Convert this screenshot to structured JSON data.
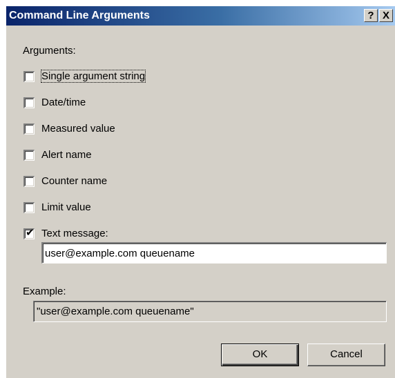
{
  "dialog": {
    "title": "Command Line Arguments",
    "help_button": "?",
    "close_button": "X"
  },
  "arguments_label": "Arguments:",
  "checkboxes": [
    {
      "label": "Single argument string",
      "checked": false,
      "focused": true
    },
    {
      "label": "Date/time",
      "checked": false
    },
    {
      "label": "Measured value",
      "checked": false
    },
    {
      "label": "Alert name",
      "checked": false
    },
    {
      "label": "Counter name",
      "checked": false
    },
    {
      "label": "Limit value",
      "checked": false
    },
    {
      "label": "Text message:",
      "checked": true
    }
  ],
  "text_message_value": "user@example.com queuename",
  "example_label": "Example:",
  "example_value": "\"user@example.com queuename\"",
  "buttons": {
    "ok": "OK",
    "cancel": "Cancel"
  },
  "colors": {
    "dialog_bg": "#d4d0c8",
    "title_start": "#0a246a",
    "title_end": "#a6caf0"
  }
}
